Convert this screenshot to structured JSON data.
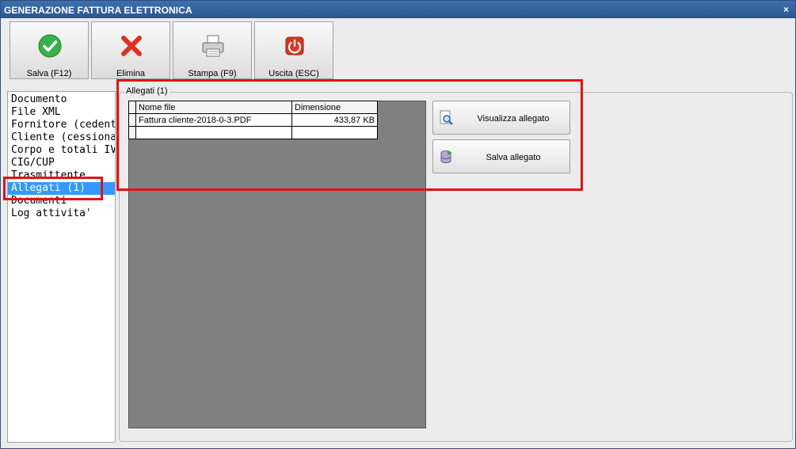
{
  "window": {
    "title": "GENERAZIONE FATTURA ELETTRONICA",
    "close_glyph": "×"
  },
  "toolbar": {
    "buttons": [
      {
        "label": "Salva (F12)",
        "icon": "checkmark-icon",
        "color": "#2eaa3c"
      },
      {
        "label": "Elimina",
        "icon": "delete-x-icon",
        "color": "#e03020"
      },
      {
        "label": "Stampa (F9)",
        "icon": "printer-icon",
        "color": "#888888"
      },
      {
        "label": "Uscita (ESC)",
        "icon": "power-icon",
        "color": "#d9381e"
      }
    ]
  },
  "nav": {
    "items": [
      {
        "label": "Documento"
      },
      {
        "label": "File XML"
      },
      {
        "label": "Fornitore (cedente)"
      },
      {
        "label": "Cliente (cessionario)"
      },
      {
        "label": "Corpo e totali IVA"
      },
      {
        "label": "CIG/CUP"
      },
      {
        "label": "Trasmittente"
      },
      {
        "label": "Allegati (1)"
      },
      {
        "label": "Documenti"
      },
      {
        "label": "Log attivita'"
      }
    ],
    "selected": "Allegati (1)"
  },
  "attachments": {
    "group_title": "Allegati (1)",
    "columns": [
      "Nome file",
      "Dimensione"
    ],
    "rows": [
      {
        "name": "Fattura cliente-2018-0-3.PDF",
        "size": "433,87 KB"
      }
    ],
    "buttons": {
      "view": "Visualizza allegato",
      "save": "Salva allegato"
    }
  },
  "annotations": {
    "highlight_color": "#e31212"
  }
}
